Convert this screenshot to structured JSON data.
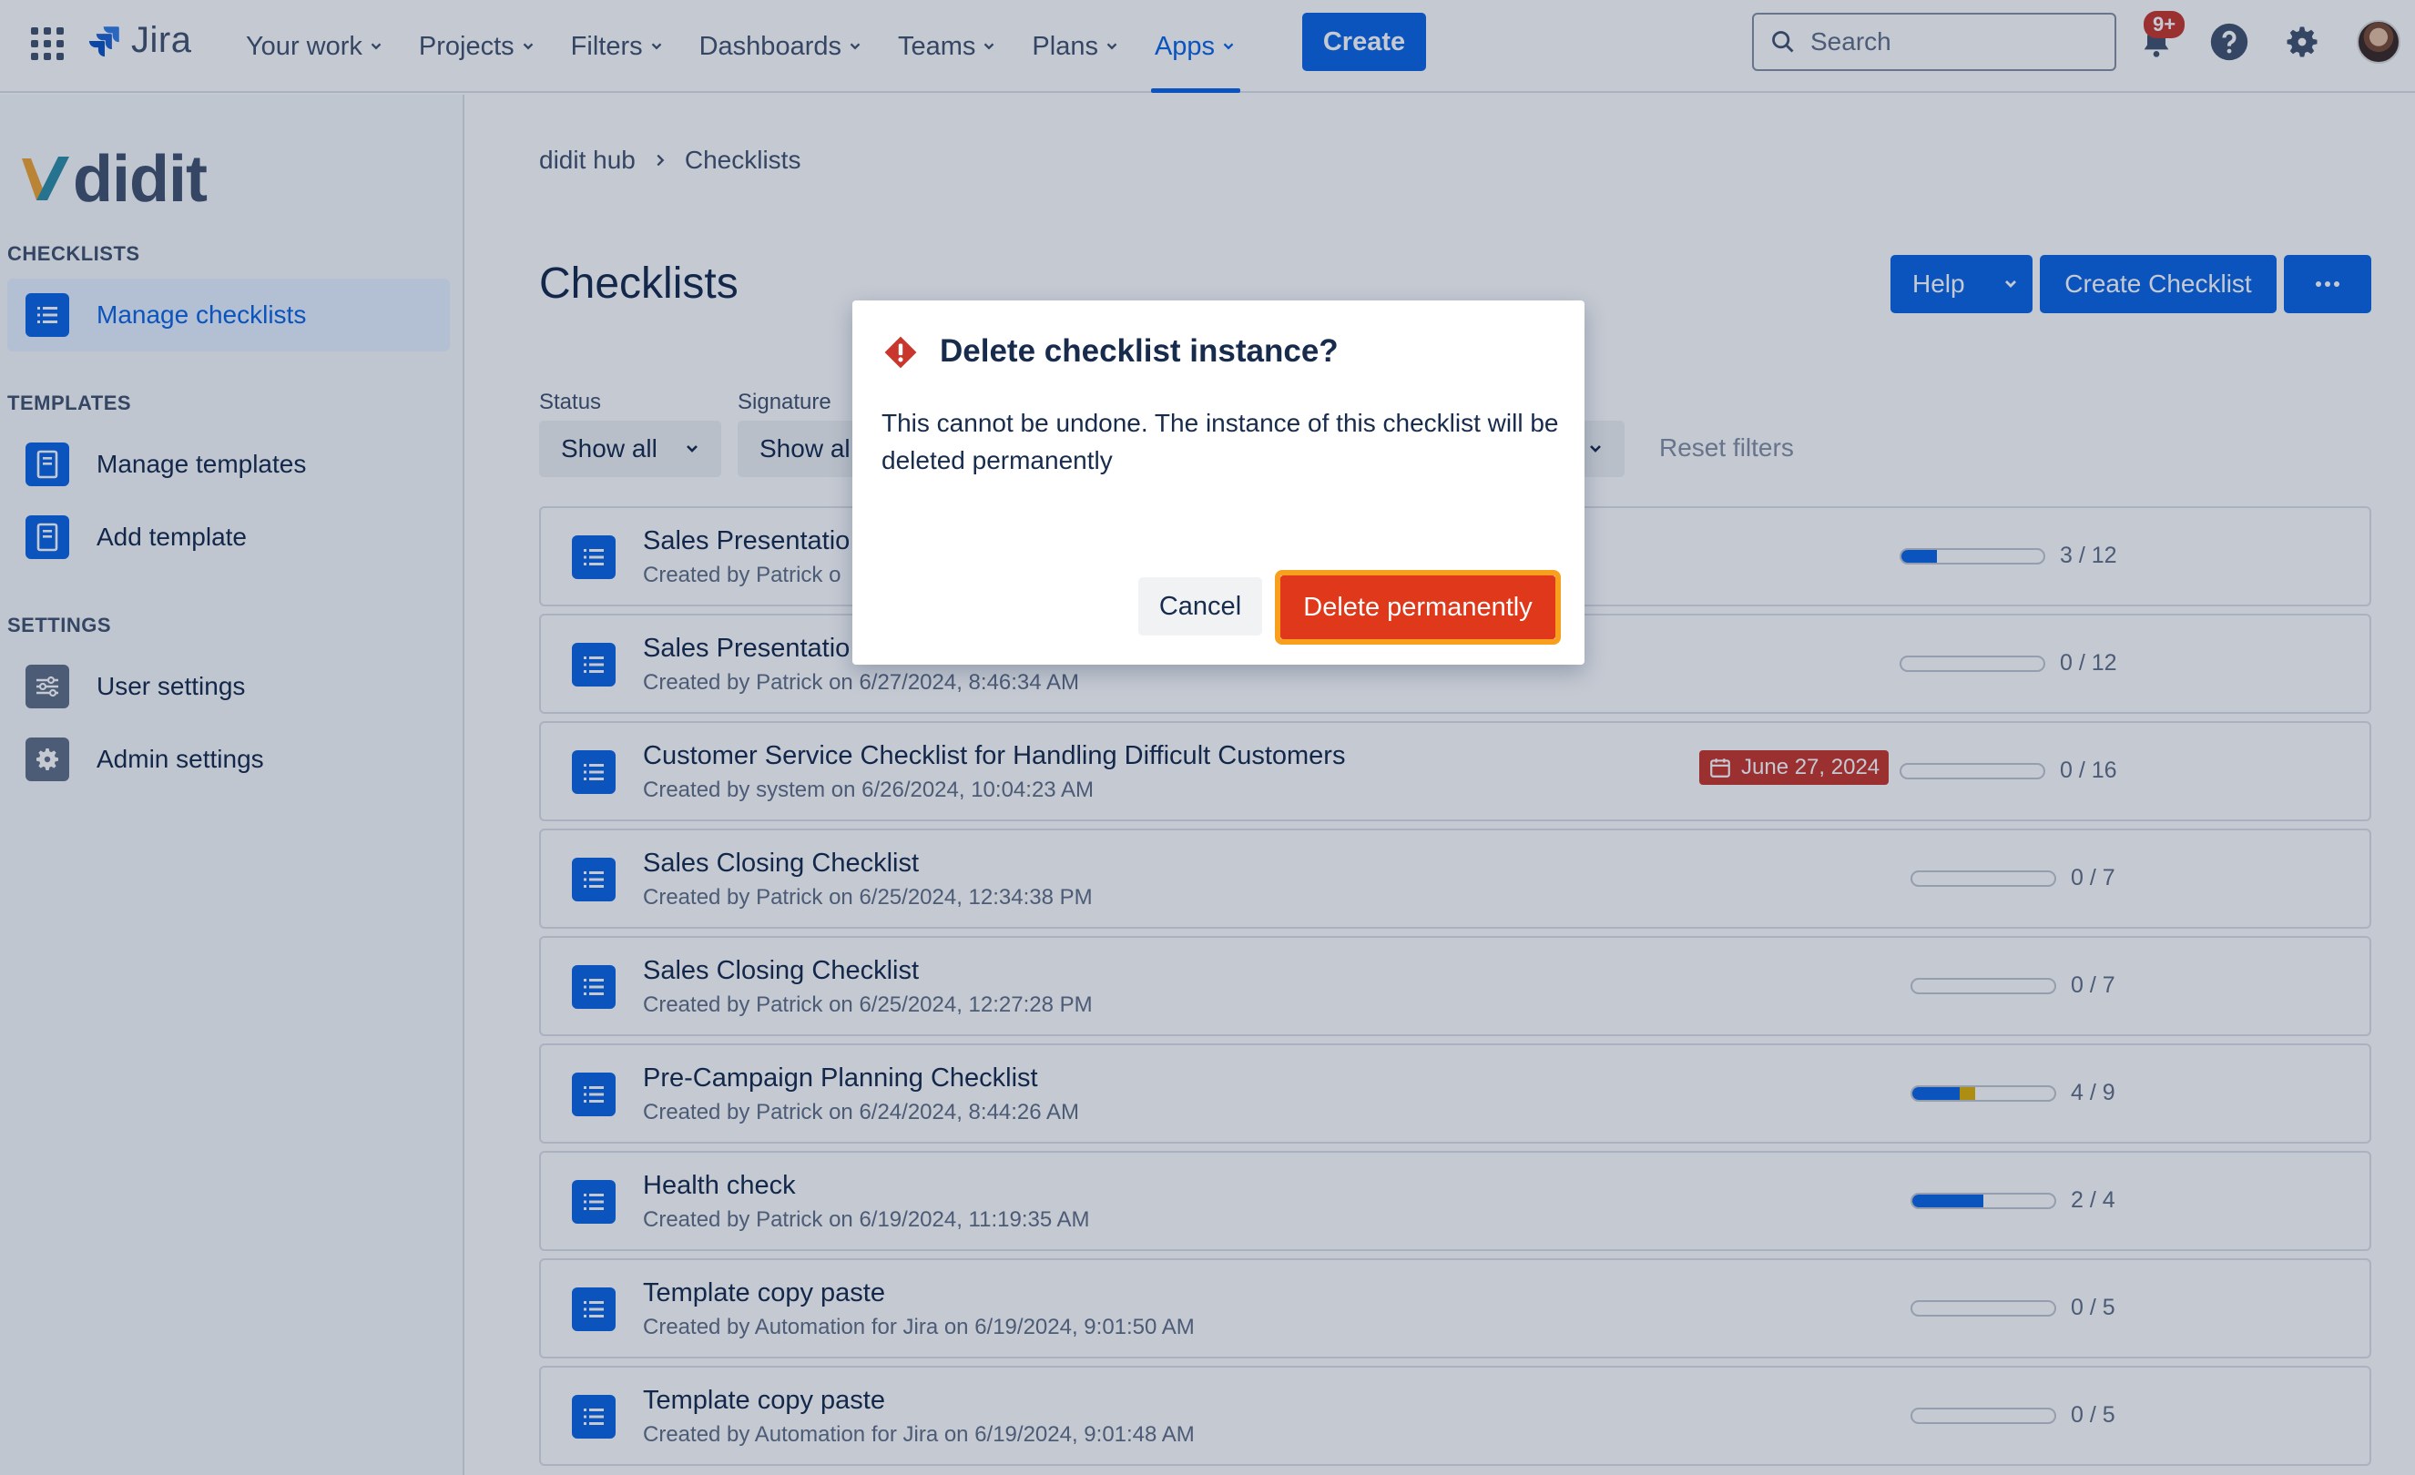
{
  "topnav": {
    "logo_name": "Jira",
    "items": [
      {
        "label": "Your work"
      },
      {
        "label": "Projects"
      },
      {
        "label": "Filters"
      },
      {
        "label": "Dashboards"
      },
      {
        "label": "Teams"
      },
      {
        "label": "Plans"
      },
      {
        "label": "Apps",
        "active": true
      }
    ],
    "create_label": "Create",
    "search_placeholder": "Search",
    "notification_badge": "9+",
    "icons": [
      "app-switcher-icon",
      "jira-logo-icon",
      "search-icon",
      "notification-icon",
      "help-icon",
      "settings-icon",
      "avatar"
    ]
  },
  "sidebar": {
    "logo_text": "didit",
    "sections": [
      {
        "title": "CHECKLISTS",
        "items": [
          {
            "label": "Manage checklists",
            "icon": "list-icon",
            "active": true
          }
        ]
      },
      {
        "title": "TEMPLATES",
        "items": [
          {
            "label": "Manage templates",
            "icon": "template-icon"
          },
          {
            "label": "Add template",
            "icon": "template-icon"
          }
        ]
      },
      {
        "title": "SETTINGS",
        "items": [
          {
            "label": "User settings",
            "icon": "sliders-icon"
          },
          {
            "label": "Admin settings",
            "icon": "gear-icon"
          }
        ]
      }
    ]
  },
  "main": {
    "breadcrumb": [
      "didit hub",
      "Checklists"
    ],
    "title": "Checklists",
    "buttons": {
      "help": "Help",
      "create_checklist": "Create Checklist",
      "more": "..."
    },
    "filters": {
      "status_label": "Status",
      "status_value": "Show all",
      "signature_label": "Signature",
      "signature_value": "Show al",
      "reset": "Reset filters"
    },
    "rows": [
      {
        "title": "Sales Presentatio",
        "subtitle": "Created by Patrick o",
        "done": 3,
        "total": 12,
        "count": "3 / 12"
      },
      {
        "title": "Sales Presentatio",
        "subtitle": "Created by Patrick on 6/27/2024, 8:46:34 AM",
        "done": 0,
        "total": 12,
        "count": "0 / 12"
      },
      {
        "title": "Customer Service Checklist for Handling Difficult Customers",
        "subtitle": "Created by system on 6/26/2024, 10:04:23 AM",
        "done": 0,
        "total": 16,
        "count": "0 / 16",
        "due": "June 27, 2024"
      },
      {
        "title": "Sales Closing Checklist",
        "subtitle": "Created by Patrick on 6/25/2024, 12:34:38 PM",
        "done": 0,
        "total": 7,
        "count": "0 / 7"
      },
      {
        "title": "Sales Closing Checklist",
        "subtitle": "Created by Patrick on 6/25/2024, 12:27:28 PM",
        "done": 0,
        "total": 7,
        "count": "0 / 7"
      },
      {
        "title": "Pre-Campaign Planning Checklist",
        "subtitle": "Created by Patrick on 6/24/2024, 8:44:26 AM",
        "done": 3,
        "partial": 1,
        "total": 9,
        "count": "4 / 9"
      },
      {
        "title": "Health check",
        "subtitle": "Created by Patrick on 6/19/2024, 11:19:35 AM",
        "done": 2,
        "total": 4,
        "count": "2 / 4"
      },
      {
        "title": "Template copy paste",
        "subtitle": "Created by Automation for Jira on 6/19/2024, 9:01:50 AM",
        "done": 0,
        "total": 5,
        "count": "0 / 5"
      },
      {
        "title": "Template copy paste",
        "subtitle": "Created by Automation for Jira on 6/19/2024, 9:01:48 AM",
        "done": 0,
        "total": 5,
        "count": "0 / 5"
      }
    ]
  },
  "modal": {
    "title": "Delete checklist instance?",
    "body": "This cannot be undone. The instance of this checklist will be deleted permanently",
    "cancel": "Cancel",
    "confirm": "Delete permanently"
  },
  "colors": {
    "brand": "#0c66e4",
    "danger": "#e0381a",
    "focus": "#f8a01d",
    "partial": "#e2b203"
  }
}
